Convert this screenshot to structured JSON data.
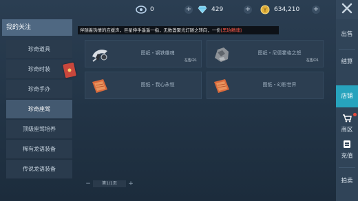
{
  "currencies": [
    {
      "icon": "coupon-icon",
      "value": "0"
    },
    {
      "icon": "diamond-icon",
      "value": "429"
    },
    {
      "icon": "gold-coin-icon",
      "value": "634,210"
    }
  ],
  "sidebar": {
    "header": "我的关注",
    "items": [
      {
        "label": "珍奇道具"
      },
      {
        "label": "珍奇时装"
      },
      {
        "label": "珍奇手办"
      },
      {
        "label": "珍奇座驾"
      },
      {
        "label": "顶级座驾培养"
      },
      {
        "label": "稀有龙语装备"
      },
      {
        "label": "传说龙语装备"
      }
    ],
    "active_index": 3
  },
  "notice": {
    "text": "伴随着热情的应援声，巨星伸手遥遥一指，无数盏聚光灯随之转向，一份",
    "highlight": "[黑珀精魂]"
  },
  "items": [
    {
      "name": "图纸・钢铁雄魂",
      "stock": "在售中1",
      "thumb": "steel-soul-icon"
    },
    {
      "name": "图纸・尼德霍格之怒",
      "stock": "在售中1",
      "thumb": "nidhogg-icon"
    },
    {
      "name": "图纸・我心永恒",
      "stock": "",
      "thumb": "blueprint-scroll-icon"
    },
    {
      "name": "图纸・幻影世界",
      "stock": "",
      "thumb": "blueprint-scroll-icon"
    }
  ],
  "pager": {
    "prev": "−",
    "text": "第1/1页",
    "next": "+"
  },
  "rightnav": [
    {
      "label": "出售",
      "active": false
    },
    {
      "label": "结算",
      "active": false
    },
    {
      "label": "店铺",
      "active": true
    },
    {
      "label": "商区",
      "active": false
    },
    {
      "label": "充值",
      "active": false
    },
    {
      "label": "拍卖",
      "active": false
    }
  ]
}
